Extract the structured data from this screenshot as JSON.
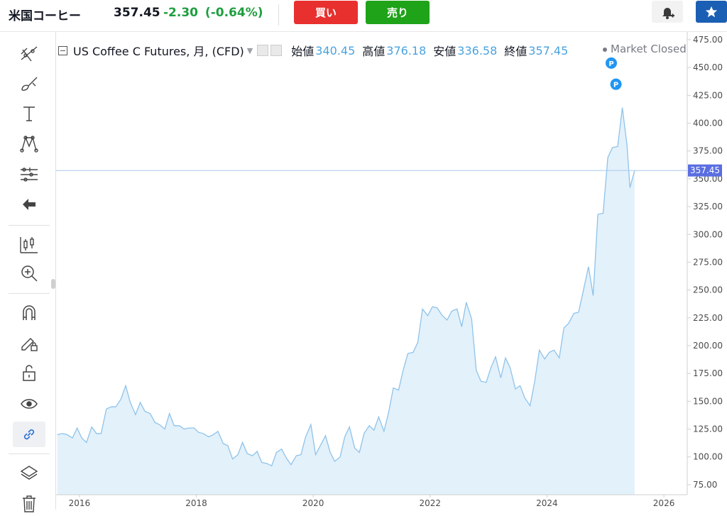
{
  "header": {
    "instrument": "米国コーヒー",
    "price": "357.45",
    "change": "-2.30",
    "change_pct": "(-0.64%)",
    "buy_label": "買い",
    "sell_label": "売り"
  },
  "legend": {
    "symbol": "US Coffee C Futures, 月, (CFD)",
    "open_label": "始値",
    "open": "340.45",
    "high_label": "高値",
    "high": "376.18",
    "low_label": "安値",
    "low": "336.58",
    "close_label": "終値",
    "close": "357.45",
    "status": "Market Closed"
  },
  "toolbar": {
    "tools": [
      "crosshair-lines-icon",
      "brush-icon",
      "text-icon",
      "pattern-icon",
      "measure-icon",
      "back-arrow-icon",
      "candles-icon",
      "zoom-in-icon",
      "magnet-icon",
      "pencil-lock-icon",
      "unlock-icon",
      "eye-icon",
      "link-icon",
      "layers-icon",
      "trash-icon"
    ]
  },
  "colors": {
    "line": "#8ec3ea",
    "area": "#e3f1fb",
    "last_price": "#5b6ee1",
    "buy": "#e8302e",
    "sell": "#1fa319",
    "positive": "#1f9e3f"
  },
  "chart_data": {
    "type": "area",
    "last_price_label": "357.45",
    "y_ticks": [
      "75.00",
      "100.00",
      "125.00",
      "150.00",
      "175.00",
      "200.00",
      "225.00",
      "250.00",
      "275.00",
      "300.00",
      "325.00",
      "350.00",
      "375.00",
      "400.00",
      "425.00",
      "450.00",
      "475.00"
    ],
    "x_ticks": [
      "2016",
      "2018",
      "2020",
      "2022",
      "2024",
      "2026"
    ],
    "xlim": [
      2015.6,
      2026.4
    ],
    "ylim": [
      66,
      482
    ],
    "markers": [
      {
        "x": 2025.1,
        "y": 454,
        "label": "P"
      },
      {
        "x": 2025.18,
        "y": 435,
        "label": "P"
      }
    ],
    "series": [
      {
        "x": 2015.62,
        "y": 120
      },
      {
        "x": 2015.71,
        "y": 121
      },
      {
        "x": 2015.79,
        "y": 120
      },
      {
        "x": 2015.88,
        "y": 117
      },
      {
        "x": 2015.96,
        "y": 126
      },
      {
        "x": 2016.04,
        "y": 117
      },
      {
        "x": 2016.12,
        "y": 113
      },
      {
        "x": 2016.21,
        "y": 127
      },
      {
        "x": 2016.29,
        "y": 121
      },
      {
        "x": 2016.37,
        "y": 121
      },
      {
        "x": 2016.46,
        "y": 143
      },
      {
        "x": 2016.54,
        "y": 145
      },
      {
        "x": 2016.62,
        "y": 145
      },
      {
        "x": 2016.71,
        "y": 152
      },
      {
        "x": 2016.79,
        "y": 164
      },
      {
        "x": 2016.87,
        "y": 149
      },
      {
        "x": 2016.96,
        "y": 138
      },
      {
        "x": 2017.04,
        "y": 149
      },
      {
        "x": 2017.12,
        "y": 141
      },
      {
        "x": 2017.21,
        "y": 139
      },
      {
        "x": 2017.29,
        "y": 131
      },
      {
        "x": 2017.37,
        "y": 129
      },
      {
        "x": 2017.46,
        "y": 125
      },
      {
        "x": 2017.54,
        "y": 139
      },
      {
        "x": 2017.62,
        "y": 128
      },
      {
        "x": 2017.71,
        "y": 128
      },
      {
        "x": 2017.79,
        "y": 125
      },
      {
        "x": 2017.87,
        "y": 126
      },
      {
        "x": 2017.96,
        "y": 126
      },
      {
        "x": 2018.04,
        "y": 122
      },
      {
        "x": 2018.12,
        "y": 121
      },
      {
        "x": 2018.21,
        "y": 118
      },
      {
        "x": 2018.29,
        "y": 120
      },
      {
        "x": 2018.37,
        "y": 123
      },
      {
        "x": 2018.46,
        "y": 112
      },
      {
        "x": 2018.54,
        "y": 110
      },
      {
        "x": 2018.62,
        "y": 98
      },
      {
        "x": 2018.71,
        "y": 102
      },
      {
        "x": 2018.79,
        "y": 113
      },
      {
        "x": 2018.87,
        "y": 103
      },
      {
        "x": 2018.96,
        "y": 101
      },
      {
        "x": 2019.04,
        "y": 105
      },
      {
        "x": 2019.12,
        "y": 95
      },
      {
        "x": 2019.21,
        "y": 94
      },
      {
        "x": 2019.29,
        "y": 92
      },
      {
        "x": 2019.37,
        "y": 104
      },
      {
        "x": 2019.46,
        "y": 107
      },
      {
        "x": 2019.54,
        "y": 99
      },
      {
        "x": 2019.62,
        "y": 93
      },
      {
        "x": 2019.71,
        "y": 101
      },
      {
        "x": 2019.79,
        "y": 102
      },
      {
        "x": 2019.87,
        "y": 118
      },
      {
        "x": 2019.96,
        "y": 129
      },
      {
        "x": 2020.04,
        "y": 102
      },
      {
        "x": 2020.12,
        "y": 110
      },
      {
        "x": 2020.21,
        "y": 119
      },
      {
        "x": 2020.29,
        "y": 104
      },
      {
        "x": 2020.37,
        "y": 96
      },
      {
        "x": 2020.46,
        "y": 100
      },
      {
        "x": 2020.54,
        "y": 118
      },
      {
        "x": 2020.62,
        "y": 127
      },
      {
        "x": 2020.71,
        "y": 108
      },
      {
        "x": 2020.79,
        "y": 104
      },
      {
        "x": 2020.87,
        "y": 121
      },
      {
        "x": 2020.96,
        "y": 128
      },
      {
        "x": 2021.04,
        "y": 124
      },
      {
        "x": 2021.12,
        "y": 136
      },
      {
        "x": 2021.21,
        "y": 123
      },
      {
        "x": 2021.29,
        "y": 140
      },
      {
        "x": 2021.37,
        "y": 162
      },
      {
        "x": 2021.46,
        "y": 160
      },
      {
        "x": 2021.54,
        "y": 178
      },
      {
        "x": 2021.62,
        "y": 193
      },
      {
        "x": 2021.71,
        "y": 194
      },
      {
        "x": 2021.79,
        "y": 203
      },
      {
        "x": 2021.87,
        "y": 233
      },
      {
        "x": 2021.96,
        "y": 227
      },
      {
        "x": 2022.04,
        "y": 235
      },
      {
        "x": 2022.12,
        "y": 234
      },
      {
        "x": 2022.21,
        "y": 227
      },
      {
        "x": 2022.29,
        "y": 223
      },
      {
        "x": 2022.37,
        "y": 231
      },
      {
        "x": 2022.46,
        "y": 233
      },
      {
        "x": 2022.54,
        "y": 217
      },
      {
        "x": 2022.62,
        "y": 239
      },
      {
        "x": 2022.71,
        "y": 224
      },
      {
        "x": 2022.79,
        "y": 178
      },
      {
        "x": 2022.87,
        "y": 168
      },
      {
        "x": 2022.96,
        "y": 167
      },
      {
        "x": 2023.04,
        "y": 180
      },
      {
        "x": 2023.12,
        "y": 190
      },
      {
        "x": 2023.21,
        "y": 171
      },
      {
        "x": 2023.29,
        "y": 189
      },
      {
        "x": 2023.37,
        "y": 180
      },
      {
        "x": 2023.46,
        "y": 161
      },
      {
        "x": 2023.54,
        "y": 164
      },
      {
        "x": 2023.62,
        "y": 153
      },
      {
        "x": 2023.71,
        "y": 146
      },
      {
        "x": 2023.79,
        "y": 168
      },
      {
        "x": 2023.87,
        "y": 196
      },
      {
        "x": 2023.96,
        "y": 188
      },
      {
        "x": 2024.04,
        "y": 194
      },
      {
        "x": 2024.12,
        "y": 196
      },
      {
        "x": 2024.21,
        "y": 189
      },
      {
        "x": 2024.29,
        "y": 216
      },
      {
        "x": 2024.37,
        "y": 220
      },
      {
        "x": 2024.46,
        "y": 229
      },
      {
        "x": 2024.54,
        "y": 230
      },
      {
        "x": 2024.62,
        "y": 249
      },
      {
        "x": 2024.71,
        "y": 271
      },
      {
        "x": 2024.79,
        "y": 245
      },
      {
        "x": 2024.87,
        "y": 318
      },
      {
        "x": 2024.96,
        "y": 319
      },
      {
        "x": 2025.04,
        "y": 369
      },
      {
        "x": 2025.12,
        "y": 378
      },
      {
        "x": 2025.21,
        "y": 379
      },
      {
        "x": 2025.29,
        "y": 414
      },
      {
        "x": 2025.37,
        "y": 380
      },
      {
        "x": 2025.42,
        "y": 342
      },
      {
        "x": 2025.5,
        "y": 357.45
      }
    ]
  }
}
